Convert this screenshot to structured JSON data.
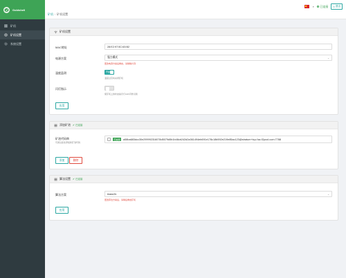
{
  "app": {
    "brand": "Goldshell"
  },
  "sidebar": {
    "items": [
      {
        "label": "矿机",
        "icon": "dashboard-icon",
        "active": false
      },
      {
        "label": "矿机设置",
        "icon": "settings-icon",
        "active": true
      },
      {
        "label": "系统设置",
        "icon": "gear-icon",
        "active": false
      }
    ]
  },
  "header": {
    "breadcrumb": [
      "矿机",
      "矿机设置"
    ],
    "language_flag": "cn-flag-icon",
    "connection_label": "已连接",
    "logout_label": "退出"
  },
  "miner_settings": {
    "title": "矿机设置",
    "mac_label": "MAC地址",
    "mac_value": "28:E2:97:5C:63:B2",
    "power_label": "电源方案",
    "power_value": "强力模式",
    "power_hint": "更改电源方案后重启，请稍等片刻",
    "temp_label": "温度监测",
    "temp_toggle_text": "开启",
    "temp_hint": "温度过高将关闭矿机",
    "led_label": "闪灯指示",
    "led_hint": "使矿机上的状态指示灯LED闪烁识别",
    "apply_label": "应用"
  },
  "key_settings": {
    "title": "添加矿池",
    "status": "已连接",
    "key_label": "矿池代码串",
    "key_sublabel": "可通过此处添加新矿池代码",
    "key_tag": "已启用",
    "key_value": "a58ba683dcc30e299992316078d5079d5b1b48cb242d2a361494eb691e178c18b592e219e85ac123@stratum+tcp://ac.f2pool.com:7788",
    "add_label": "添加",
    "delete_label": "删除"
  },
  "algo_settings": {
    "title": "算法设置",
    "status": "已连接",
    "algo_label": "算法方案",
    "algo_value": "blake2b",
    "algo_hint": "更改算法方案后，请稍后重启矿机",
    "apply_label": "应用"
  },
  "colors": {
    "brand": "#3ea456",
    "accent": "#2aa7a2",
    "danger": "#e04a3e",
    "sidebar": "#2f3b40"
  }
}
